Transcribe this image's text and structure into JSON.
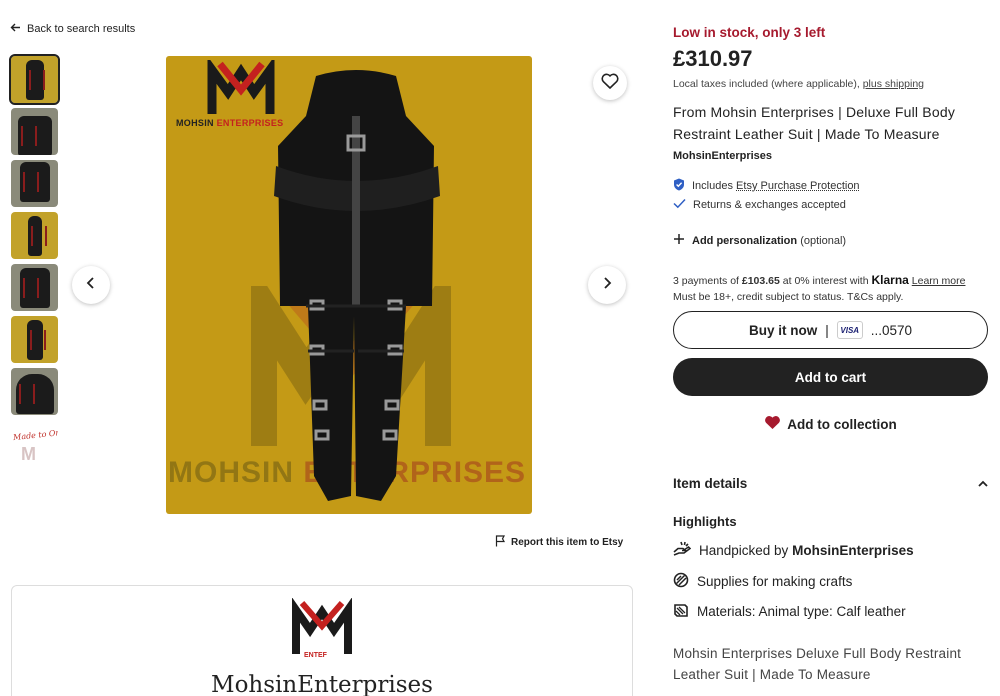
{
  "nav": {
    "back_label": "Back to search results"
  },
  "listing": {
    "stock_text": "Low in stock, only 3 left",
    "price": "£310.97",
    "tax_text": "Local taxes included (where applicable),",
    "shipping_link": "plus shipping",
    "title": "From Mohsin Enterprises | Deluxe Full Body Restraint Leather Suit | Made To Measure",
    "shop_name": "MohsinEnterprises",
    "protection_prefix": "Includes",
    "protection_link": "Etsy Purchase Protection",
    "returns_text": "Returns & exchanges accepted",
    "personalization_label": "Add personalization",
    "personalization_optional": "(optional)"
  },
  "klarna": {
    "line1_prefix": "3 payments of",
    "amount": "£103.65",
    "line1_mid": "at 0% interest with",
    "brand": "Klarna",
    "learn_more": "Learn more",
    "line2": "Must be 18+, credit subject to status. T&Cs apply."
  },
  "buttons": {
    "buy_now": "Buy it now",
    "buy_sep": "|",
    "card_brand": "VISA",
    "card_last4": "...0570",
    "add_cart": "Add to cart",
    "add_collection": "Add to collection",
    "report": "Report this item to Etsy"
  },
  "details": {
    "header": "Item details",
    "highlights_label": "Highlights",
    "hl1_prefix": "Handpicked by",
    "hl1_shop": "MohsinEnterprises",
    "hl2": "Supplies for making crafts",
    "hl3": "Materials: Animal type: Calf leather",
    "description": "Mohsin Enterprises Deluxe Full Body Restraint Leather Suit | Made To Measure"
  },
  "gallery": {
    "image_logo_1": "MOHSIN",
    "image_logo_2": "ENTERPRISES",
    "watermark_1": "MOHSIN",
    "watermark_2": "ENTERPRISES",
    "thumb_made_text": "Made to Order"
  },
  "shop_card": {
    "name": "MohsinEnterprises",
    "logo_text": "ENTEF"
  },
  "colors": {
    "stock_red": "#a61a2e",
    "brand_red": "#c4211f",
    "image_bg": "#c49a16",
    "button_dark": "#222222"
  },
  "icons": [
    "arrow-left-icon",
    "heart-outline-icon",
    "chevron-left-icon",
    "chevron-right-icon",
    "flag-icon",
    "shield-check-icon",
    "check-icon",
    "plus-icon",
    "heart-filled-icon",
    "chevron-up-icon",
    "hand-icon",
    "supplies-icon",
    "materials-icon"
  ]
}
